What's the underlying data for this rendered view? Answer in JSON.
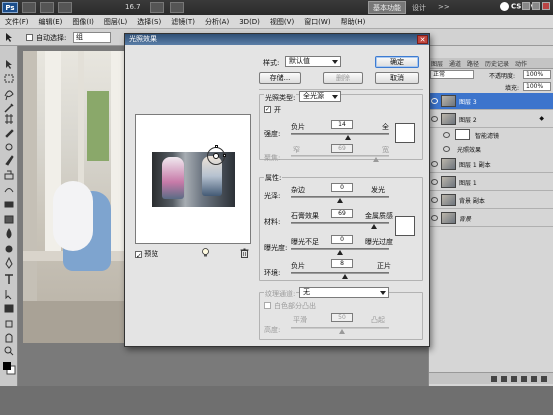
{
  "titlebar": {
    "app_icon": "Ps",
    "zoom": "16.7",
    "mode_button": "基本功能",
    "design": "设计",
    "more": ">>",
    "cs_live": "CS Live"
  },
  "menubar": {
    "items": [
      "文件(F)",
      "编辑(E)",
      "图像(I)",
      "图层(L)",
      "选择(S)",
      "滤镜(T)",
      "分析(A)",
      "3D(D)",
      "视图(V)",
      "窗口(W)",
      "帮助(H)"
    ]
  },
  "options": {
    "auto_select_label": "自动选择:",
    "auto_select_value": "组"
  },
  "dialog": {
    "title": "光照效果",
    "style_label": "样式:",
    "style_value": "默认值",
    "ok_button": "确定",
    "cancel_button": "取消",
    "save_button": "存储...",
    "delete_button": "删除",
    "light_type_label": "光照类型:",
    "light_type_value": "全光源",
    "on_label": "开",
    "intensity_label": "强度:",
    "intensity_left": "负片",
    "intensity_right": "全",
    "intensity_value": "14",
    "focus_label": "聚焦:",
    "focus_left": "窄",
    "focus_right": "宽",
    "focus_value": "69",
    "properties_label": "属性:",
    "gloss_label": "光泽:",
    "gloss_left": "杂边",
    "gloss_right": "发光",
    "gloss_value": "0",
    "material_label": "材料:",
    "material_left": "石膏效果",
    "material_right": "金属质感",
    "material_value": "69",
    "exposure_label": "曝光度:",
    "exposure_left": "曝光不足",
    "exposure_right": "曝光过度",
    "exposure_value": "0",
    "ambience_label": "环境:",
    "ambience_left": "负片",
    "ambience_right": "正片",
    "ambience_value": "8",
    "texture_label": "纹理通道:",
    "texture_value": "无",
    "white_high_label": "白色部分凸出",
    "height_label": "高度:",
    "height_left": "平滑",
    "height_right": "凸起",
    "height_value": "50",
    "preview_label": "预览"
  },
  "layers_panel": {
    "tabs": [
      "图层",
      "通道",
      "路径",
      "历史记录",
      "动作"
    ],
    "blend_mode": "正常",
    "opacity_label": "不透明度:",
    "opacity_value": "100%",
    "fill_label": "填充:",
    "fill_value": "100%",
    "layers": [
      {
        "name": "图层 3",
        "selected": true
      },
      {
        "name": "图层 2",
        "selected": false
      },
      {
        "name": "智能滤镜",
        "selected": false,
        "sub": true
      },
      {
        "name": "光照效果",
        "selected": false,
        "sub": true
      },
      {
        "name": "图层 1 副本",
        "selected": false
      },
      {
        "name": "图层 1",
        "selected": false
      },
      {
        "name": "背景 副本",
        "selected": false
      },
      {
        "name": "背景",
        "selected": false
      }
    ]
  }
}
